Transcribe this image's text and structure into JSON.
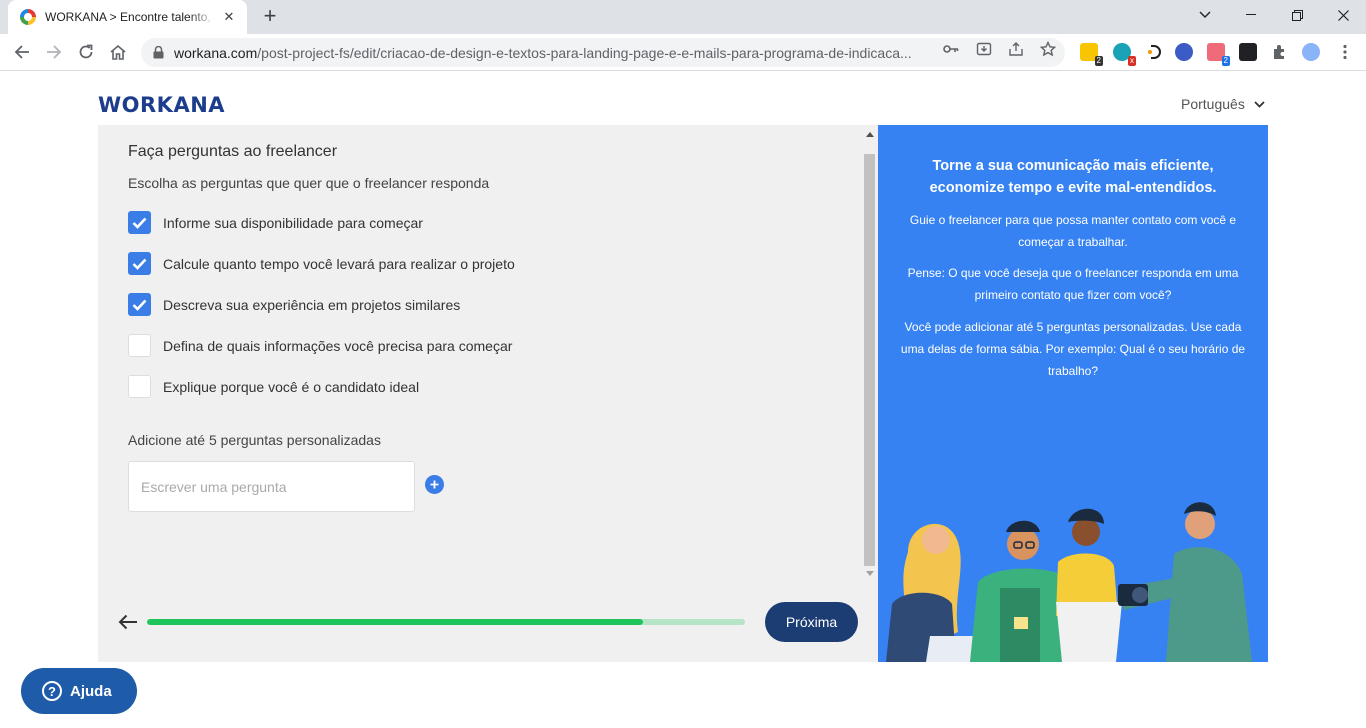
{
  "browser": {
    "tab_title": "WORKANA > Encontre talento, e",
    "tab_close": "✕",
    "new_tab": "+",
    "url_domain": "workana.com",
    "url_path": "/post-project-fs/edit/criacao-de-design-e-textos-para-landing-page-e-e-mails-para-programa-de-indicaca...",
    "extensions": [
      {
        "name": "ext-note",
        "color": "#f7c600",
        "badge": "2"
      },
      {
        "name": "ext-teal",
        "color": "#1aa3b6",
        "badge": "x"
      },
      {
        "name": "ext-d",
        "color": "#ffffff",
        "badge": ""
      },
      {
        "name": "ext-eyes",
        "color": "#3b5cc6",
        "badge": ""
      },
      {
        "name": "ext-pink",
        "color": "#ef6b7a",
        "badge": "2"
      },
      {
        "name": "ext-dark",
        "color": "#202124",
        "badge": ""
      }
    ]
  },
  "header": {
    "logo": "WORKANA",
    "language": "Português"
  },
  "form": {
    "title": "Faça perguntas ao freelancer",
    "subtitle": "Escolha as perguntas que quer que o freelancer responda",
    "questions": [
      {
        "label": "Informe sua disponibilidade para começar",
        "checked": true
      },
      {
        "label": "Calcule quanto tempo você levará para realizar o projeto",
        "checked": true
      },
      {
        "label": "Descreva sua experiência em projetos similares",
        "checked": true
      },
      {
        "label": "Defina de quais informações você precisa para começar",
        "checked": false
      },
      {
        "label": "Explique porque você é o candidato ideal",
        "checked": false
      }
    ],
    "custom_title": "Adicione até 5 perguntas personalizadas",
    "custom_placeholder": "Escrever uma pergunta",
    "progress": 0.83,
    "next_label": "Próxima"
  },
  "sidebar": {
    "heading": "Torne a sua comunicação mais eficiente, economize tempo e evite mal-entendidos.",
    "p1": "Guie o freelancer para que possa manter contato com você e começar a trabalhar.",
    "p2": "Pense: O que você deseja que o freelancer responda em uma primeiro contato que fizer com você?",
    "p3": "Você pode adicionar até 5 perguntas personalizadas. Use cada uma delas de forma sábia. Por exemplo: Qual é o seu horário de trabalho?"
  },
  "help": {
    "label": "Ajuda",
    "icon": "?"
  },
  "colors": {
    "brand": "#1c3d8c",
    "accent": "#3a7de6",
    "sidebar_bg": "#3782f2",
    "progress": "#1fc45a",
    "button": "#1c3c74",
    "help": "#1e5ba8"
  }
}
